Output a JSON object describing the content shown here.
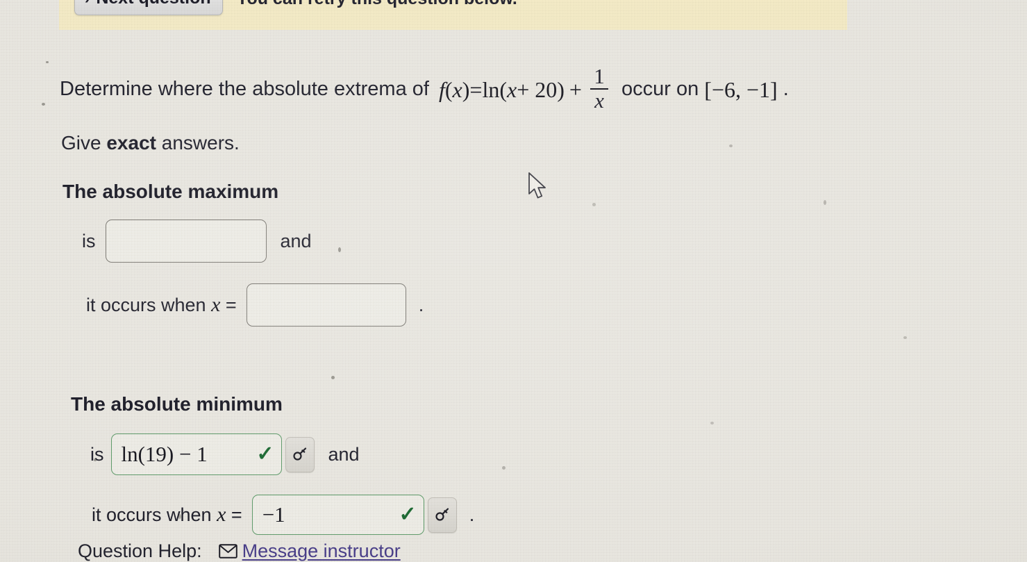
{
  "banner": {
    "next_button_chevron": "›",
    "next_button_label": "Next question",
    "retry_text": "You can retry this question below."
  },
  "question": {
    "prompt_before": "Determine where the absolute extrema of ",
    "formula": {
      "function_name": "f",
      "arg_open": "(",
      "variable": "x",
      "arg_close": ")",
      "equals": "=",
      "ln_part": "ln(",
      "ln_inner_var": "x",
      "ln_inner_rest": " + 20)",
      "plus": "+",
      "fraction_numerator": "1",
      "fraction_denominator": "x"
    },
    "prompt_middle": " occur on ",
    "interval": "[−6, −1]",
    "prompt_end": " .",
    "instruction_prefix": "Give ",
    "instruction_bold": "exact",
    "instruction_suffix": " answers."
  },
  "maximum": {
    "heading": "The absolute maximum",
    "is_label": "is",
    "is_value": "",
    "is_placeholder": "",
    "and_label": "and",
    "occurs_label": "it occurs when ",
    "occurs_var": "x",
    "occurs_equals": " =",
    "occurs_value": "",
    "period": "."
  },
  "minimum": {
    "heading": "The absolute minimum",
    "is_label": "is",
    "is_value": "ln(19) − 1",
    "is_status": "correct",
    "is_check_glyph": "✓",
    "and_label": "and",
    "occurs_label": "it occurs when ",
    "occurs_var": "x",
    "occurs_equals": " =",
    "occurs_value": "−1",
    "occurs_status": "correct",
    "occurs_check_glyph": "✓",
    "period": "."
  },
  "footer": {
    "help_label": "Question Help:",
    "message_link": "Message instructor"
  },
  "colors": {
    "banner_background": "#f7eec9",
    "page_background": "#eceae4",
    "correct_border": "#5f9d6b",
    "check_green": "#1c6b33",
    "empty_border": "#7d7a74",
    "link_purple": "#4a3f8c",
    "text": "#20202c"
  }
}
